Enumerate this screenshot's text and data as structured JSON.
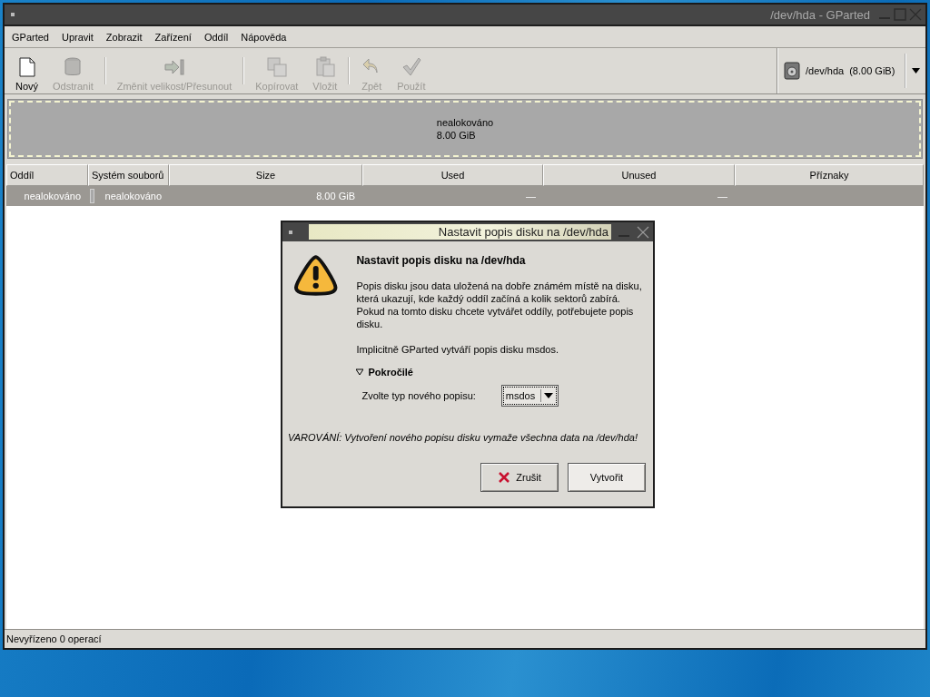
{
  "window": {
    "title": "/dev/hda - GParted"
  },
  "menu": [
    "GParted",
    "Upravit",
    "Zobrazit",
    "Zařízení",
    "Oddíl",
    "Nápověda"
  ],
  "toolbar": [
    {
      "kind": "new",
      "label": "Nový",
      "disabled": false,
      "separator_after": false
    },
    {
      "kind": "delete",
      "label": "Odstranit",
      "disabled": true,
      "separator_after": true
    },
    {
      "kind": "resize",
      "label": "Změnit velikost/Přesunout",
      "disabled": true,
      "separator_after": true
    },
    {
      "kind": "copy",
      "label": "Kopírovat",
      "disabled": true,
      "separator_after": false
    },
    {
      "kind": "paste",
      "label": "Vložit",
      "disabled": true,
      "separator_after": true
    },
    {
      "kind": "undo",
      "label": "Zpět",
      "disabled": true,
      "separator_after": false
    },
    {
      "kind": "apply",
      "label": "Použít",
      "disabled": true,
      "separator_after": false
    }
  ],
  "device": {
    "path": "/dev/hda",
    "size": "(8.00 GiB)"
  },
  "disk_map": {
    "label": "nealokováno",
    "size": "8.00 GiB",
    "selected": true
  },
  "table": {
    "columns": [
      "Oddíl",
      "Systém souborů",
      "Size",
      "Used",
      "Unused",
      "Příznaky"
    ],
    "rows": [
      {
        "partition": "nealokováno",
        "filesystem": "nealokováno",
        "color": "#a8a8a8",
        "size": "8.00 GiB",
        "used": "—",
        "unused": "—",
        "selected": true
      }
    ]
  },
  "dialog": {
    "title": "Nastavit popis disku na /dev/hda",
    "heading": "Nastavit popis disku na /dev/hda",
    "paragraphs": [
      "Popis disku jsou data uložená na dobře známém místě na disku, která ukazují, kde každý oddíl začíná a kolik sektorů zabírá. Pokud na tomto disku chcete vytvářet oddíly, potřebujete popis disku.",
      "Implicitně GParted vytváří popis disku msdos."
    ],
    "expander": {
      "label": "Pokročilé",
      "expanded": true
    },
    "type_label": "Zvolte typ nového popisu:",
    "type_value": "msdos",
    "warning": "VAROVÁNÍ: Vytvoření nového popisu disku vymaže všechna data na /dev/hda!",
    "buttons": [
      {
        "kind": "cancel",
        "label": "Zrušit",
        "focused": false
      },
      {
        "kind": "create",
        "label": "Vytvořit",
        "focused": true
      }
    ]
  },
  "status_bar": "Nevyřízeno 0 operací"
}
